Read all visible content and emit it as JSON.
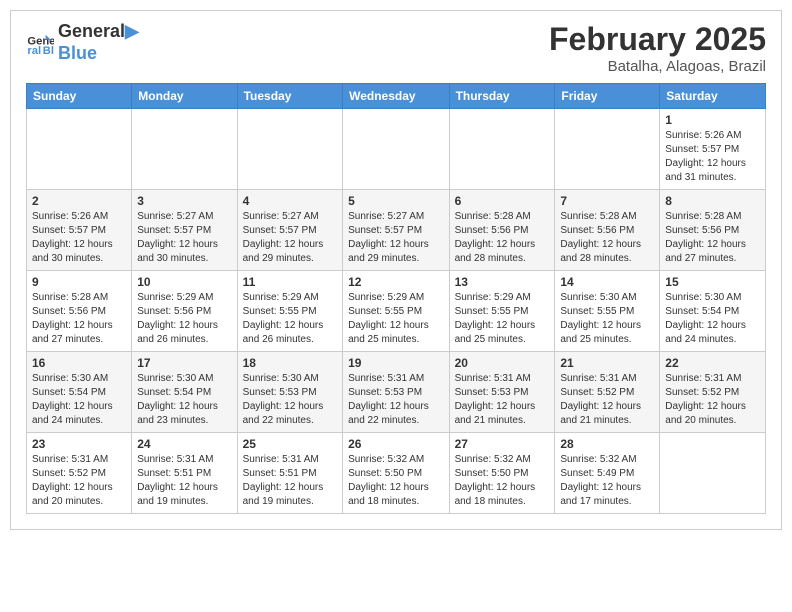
{
  "header": {
    "logo_line1": "General",
    "logo_line2": "Blue",
    "month": "February 2025",
    "location": "Batalha, Alagoas, Brazil"
  },
  "weekdays": [
    "Sunday",
    "Monday",
    "Tuesday",
    "Wednesday",
    "Thursday",
    "Friday",
    "Saturday"
  ],
  "weeks": [
    [
      {
        "day": "",
        "info": ""
      },
      {
        "day": "",
        "info": ""
      },
      {
        "day": "",
        "info": ""
      },
      {
        "day": "",
        "info": ""
      },
      {
        "day": "",
        "info": ""
      },
      {
        "day": "",
        "info": ""
      },
      {
        "day": "1",
        "info": "Sunrise: 5:26 AM\nSunset: 5:57 PM\nDaylight: 12 hours\nand 31 minutes."
      }
    ],
    [
      {
        "day": "2",
        "info": "Sunrise: 5:26 AM\nSunset: 5:57 PM\nDaylight: 12 hours\nand 30 minutes."
      },
      {
        "day": "3",
        "info": "Sunrise: 5:27 AM\nSunset: 5:57 PM\nDaylight: 12 hours\nand 30 minutes."
      },
      {
        "day": "4",
        "info": "Sunrise: 5:27 AM\nSunset: 5:57 PM\nDaylight: 12 hours\nand 29 minutes."
      },
      {
        "day": "5",
        "info": "Sunrise: 5:27 AM\nSunset: 5:57 PM\nDaylight: 12 hours\nand 29 minutes."
      },
      {
        "day": "6",
        "info": "Sunrise: 5:28 AM\nSunset: 5:56 PM\nDaylight: 12 hours\nand 28 minutes."
      },
      {
        "day": "7",
        "info": "Sunrise: 5:28 AM\nSunset: 5:56 PM\nDaylight: 12 hours\nand 28 minutes."
      },
      {
        "day": "8",
        "info": "Sunrise: 5:28 AM\nSunset: 5:56 PM\nDaylight: 12 hours\nand 27 minutes."
      }
    ],
    [
      {
        "day": "9",
        "info": "Sunrise: 5:28 AM\nSunset: 5:56 PM\nDaylight: 12 hours\nand 27 minutes."
      },
      {
        "day": "10",
        "info": "Sunrise: 5:29 AM\nSunset: 5:56 PM\nDaylight: 12 hours\nand 26 minutes."
      },
      {
        "day": "11",
        "info": "Sunrise: 5:29 AM\nSunset: 5:55 PM\nDaylight: 12 hours\nand 26 minutes."
      },
      {
        "day": "12",
        "info": "Sunrise: 5:29 AM\nSunset: 5:55 PM\nDaylight: 12 hours\nand 25 minutes."
      },
      {
        "day": "13",
        "info": "Sunrise: 5:29 AM\nSunset: 5:55 PM\nDaylight: 12 hours\nand 25 minutes."
      },
      {
        "day": "14",
        "info": "Sunrise: 5:30 AM\nSunset: 5:55 PM\nDaylight: 12 hours\nand 25 minutes."
      },
      {
        "day": "15",
        "info": "Sunrise: 5:30 AM\nSunset: 5:54 PM\nDaylight: 12 hours\nand 24 minutes."
      }
    ],
    [
      {
        "day": "16",
        "info": "Sunrise: 5:30 AM\nSunset: 5:54 PM\nDaylight: 12 hours\nand 24 minutes."
      },
      {
        "day": "17",
        "info": "Sunrise: 5:30 AM\nSunset: 5:54 PM\nDaylight: 12 hours\nand 23 minutes."
      },
      {
        "day": "18",
        "info": "Sunrise: 5:30 AM\nSunset: 5:53 PM\nDaylight: 12 hours\nand 22 minutes."
      },
      {
        "day": "19",
        "info": "Sunrise: 5:31 AM\nSunset: 5:53 PM\nDaylight: 12 hours\nand 22 minutes."
      },
      {
        "day": "20",
        "info": "Sunrise: 5:31 AM\nSunset: 5:53 PM\nDaylight: 12 hours\nand 21 minutes."
      },
      {
        "day": "21",
        "info": "Sunrise: 5:31 AM\nSunset: 5:52 PM\nDaylight: 12 hours\nand 21 minutes."
      },
      {
        "day": "22",
        "info": "Sunrise: 5:31 AM\nSunset: 5:52 PM\nDaylight: 12 hours\nand 20 minutes."
      }
    ],
    [
      {
        "day": "23",
        "info": "Sunrise: 5:31 AM\nSunset: 5:52 PM\nDaylight: 12 hours\nand 20 minutes."
      },
      {
        "day": "24",
        "info": "Sunrise: 5:31 AM\nSunset: 5:51 PM\nDaylight: 12 hours\nand 19 minutes."
      },
      {
        "day": "25",
        "info": "Sunrise: 5:31 AM\nSunset: 5:51 PM\nDaylight: 12 hours\nand 19 minutes."
      },
      {
        "day": "26",
        "info": "Sunrise: 5:32 AM\nSunset: 5:50 PM\nDaylight: 12 hours\nand 18 minutes."
      },
      {
        "day": "27",
        "info": "Sunrise: 5:32 AM\nSunset: 5:50 PM\nDaylight: 12 hours\nand 18 minutes."
      },
      {
        "day": "28",
        "info": "Sunrise: 5:32 AM\nSunset: 5:49 PM\nDaylight: 12 hours\nand 17 minutes."
      },
      {
        "day": "",
        "info": ""
      }
    ]
  ]
}
